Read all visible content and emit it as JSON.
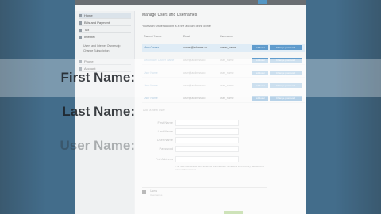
{
  "topbar": {
    "items": [
      "",
      "",
      "",
      "",
      ""
    ]
  },
  "sidebar": {
    "items": [
      {
        "label": "Home",
        "active": true
      },
      {
        "label": "Bills and Payment",
        "active": false
      },
      {
        "label": "Tax",
        "active": false
      },
      {
        "label": "Internet",
        "active": false
      },
      {
        "label": "Phone",
        "active": false
      },
      {
        "label": "Account",
        "active": false
      }
    ],
    "subitems": [
      "Users and Internet Ownership",
      "Change Subscription"
    ]
  },
  "main": {
    "heading": "Manage Users and Usernames",
    "subheading": "Your Main Owner account is at the account of the owner",
    "table": {
      "headers": [
        "Owner / Name",
        "Email",
        "Username"
      ],
      "rows": [
        {
          "name": "Main Owner",
          "email": "owner@address.co",
          "username": "owner_name",
          "edit": "Edit user",
          "change": "Change password"
        },
        {
          "name": "Secondary Owner Name",
          "email": "user@address.co",
          "username": "user_name",
          "edit": "Edit user",
          "change": "Change password"
        },
        {
          "name": "User Name",
          "email": "user@address.co",
          "username": "user_name",
          "edit": "Edit user",
          "change": "Change password"
        },
        {
          "name": "User Name",
          "email": "user@address.co",
          "username": "user_name",
          "edit": "Edit user",
          "change": "Change password"
        },
        {
          "name": "User Name",
          "email": "user@address.co",
          "username": "user_name",
          "edit": "Edit user",
          "change": "Change password"
        }
      ]
    }
  },
  "overlay": {
    "first_name": "First Name:",
    "last_name": "Last Name:",
    "user_name": "User Name:"
  },
  "form": {
    "title": "Add a new user",
    "fields": [
      "First Name",
      "Last Name",
      "User Name",
      "Password",
      "Full Address"
    ],
    "note": "The new user will be sent an email with the user name and a temporary password to access the account.",
    "user_box": {
      "title": "Users",
      "subtitle": "Usernames"
    }
  }
}
